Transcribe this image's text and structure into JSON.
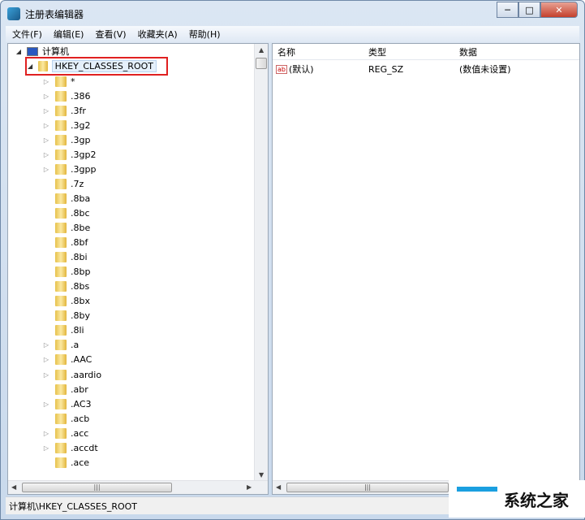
{
  "window": {
    "title": "注册表编辑器",
    "min": "─",
    "max": "□",
    "close": "✕"
  },
  "menu": [
    "文件(F)",
    "编辑(E)",
    "查看(V)",
    "收藏夹(A)",
    "帮助(H)"
  ],
  "tree": {
    "root": "计算机",
    "selected": "HKEY_CLASSES_ROOT",
    "items": [
      {
        "label": "*",
        "expandable": true
      },
      {
        "label": ".386",
        "expandable": true
      },
      {
        "label": ".3fr",
        "expandable": true
      },
      {
        "label": ".3g2",
        "expandable": true
      },
      {
        "label": ".3gp",
        "expandable": true
      },
      {
        "label": ".3gp2",
        "expandable": true
      },
      {
        "label": ".3gpp",
        "expandable": true
      },
      {
        "label": ".7z",
        "expandable": false
      },
      {
        "label": ".8ba",
        "expandable": false
      },
      {
        "label": ".8bc",
        "expandable": false
      },
      {
        "label": ".8be",
        "expandable": false
      },
      {
        "label": ".8bf",
        "expandable": false
      },
      {
        "label": ".8bi",
        "expandable": false
      },
      {
        "label": ".8bp",
        "expandable": false
      },
      {
        "label": ".8bs",
        "expandable": false
      },
      {
        "label": ".8bx",
        "expandable": false
      },
      {
        "label": ".8by",
        "expandable": false
      },
      {
        "label": ".8li",
        "expandable": false
      },
      {
        "label": ".a",
        "expandable": true
      },
      {
        "label": ".AAC",
        "expandable": true
      },
      {
        "label": ".aardio",
        "expandable": true
      },
      {
        "label": ".abr",
        "expandable": false
      },
      {
        "label": ".AC3",
        "expandable": true
      },
      {
        "label": ".acb",
        "expandable": false
      },
      {
        "label": ".acc",
        "expandable": true
      },
      {
        "label": ".accdt",
        "expandable": true
      },
      {
        "label": ".ace",
        "expandable": false
      }
    ]
  },
  "values": {
    "columns": [
      "名称",
      "类型",
      "数据"
    ],
    "rows": [
      {
        "name": "(默认)",
        "type": "REG_SZ",
        "data": "(数值未设置)",
        "icon": "ab"
      }
    ]
  },
  "status": "计算机\\HKEY_CLASSES_ROOT",
  "watermark": "系统之家",
  "colors": {
    "highlight": "#e02020"
  }
}
